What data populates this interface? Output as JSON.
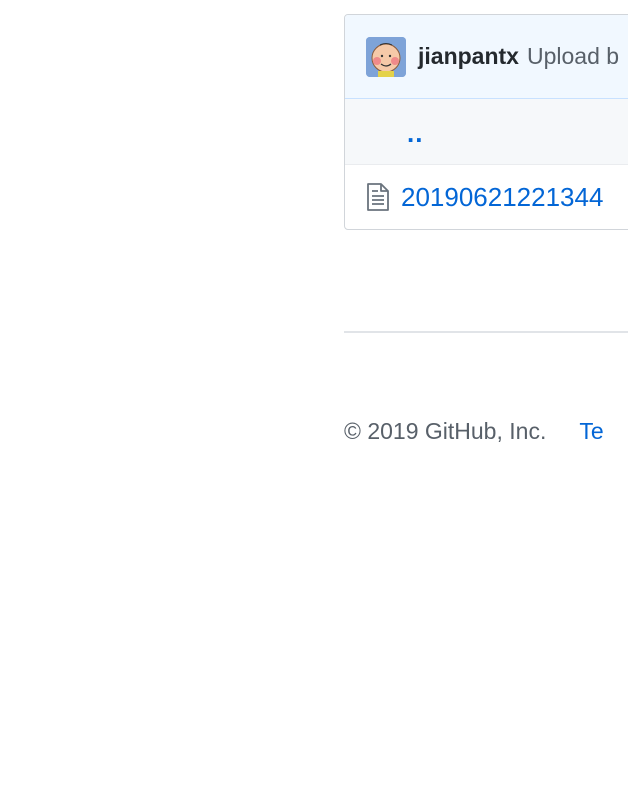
{
  "commit": {
    "author": "jianpantx",
    "message": "Upload b"
  },
  "file_list": {
    "parent_label": "..",
    "files": [
      {
        "name": "20190621221344",
        "icon": "file-text-icon"
      }
    ]
  },
  "footer": {
    "copyright": "© 2019 GitHub, Inc.",
    "links": [
      "Te"
    ]
  },
  "colors": {
    "link": "#0366d6",
    "commit_bg": "#f1f8ff",
    "row_alt_bg": "#f6f8fa",
    "border": "#d1d5da"
  }
}
